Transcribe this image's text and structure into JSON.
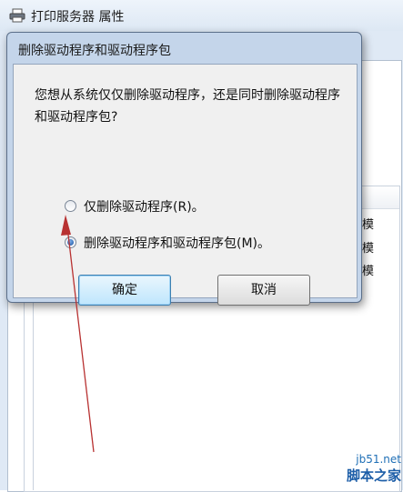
{
  "background_window": {
    "title": "打印服务器 属性",
    "list_cells": [
      "用户模",
      "用户模",
      "用户模"
    ]
  },
  "dialog": {
    "title": "删除驱动程序和驱动程序包",
    "message": "您想从系统仅仅删除驱动程序，还是同时删除驱动程序和驱动程序包?",
    "options": [
      {
        "label": "仅删除驱动程序(R)。",
        "selected": false
      },
      {
        "label": "删除驱动程序和驱动程序包(M)。",
        "selected": true
      }
    ],
    "ok_label": "确定",
    "cancel_label": "取消"
  },
  "watermark": {
    "url": "jb51.net",
    "brand": "脚本之家"
  },
  "colors": {
    "annotation_arrow": "#b83232",
    "dialog_frame": "#c4d5ea",
    "default_button_border": "#3c7fb1"
  },
  "icons": [
    "printer-icon",
    "radio-unselected-icon",
    "radio-selected-icon"
  ]
}
